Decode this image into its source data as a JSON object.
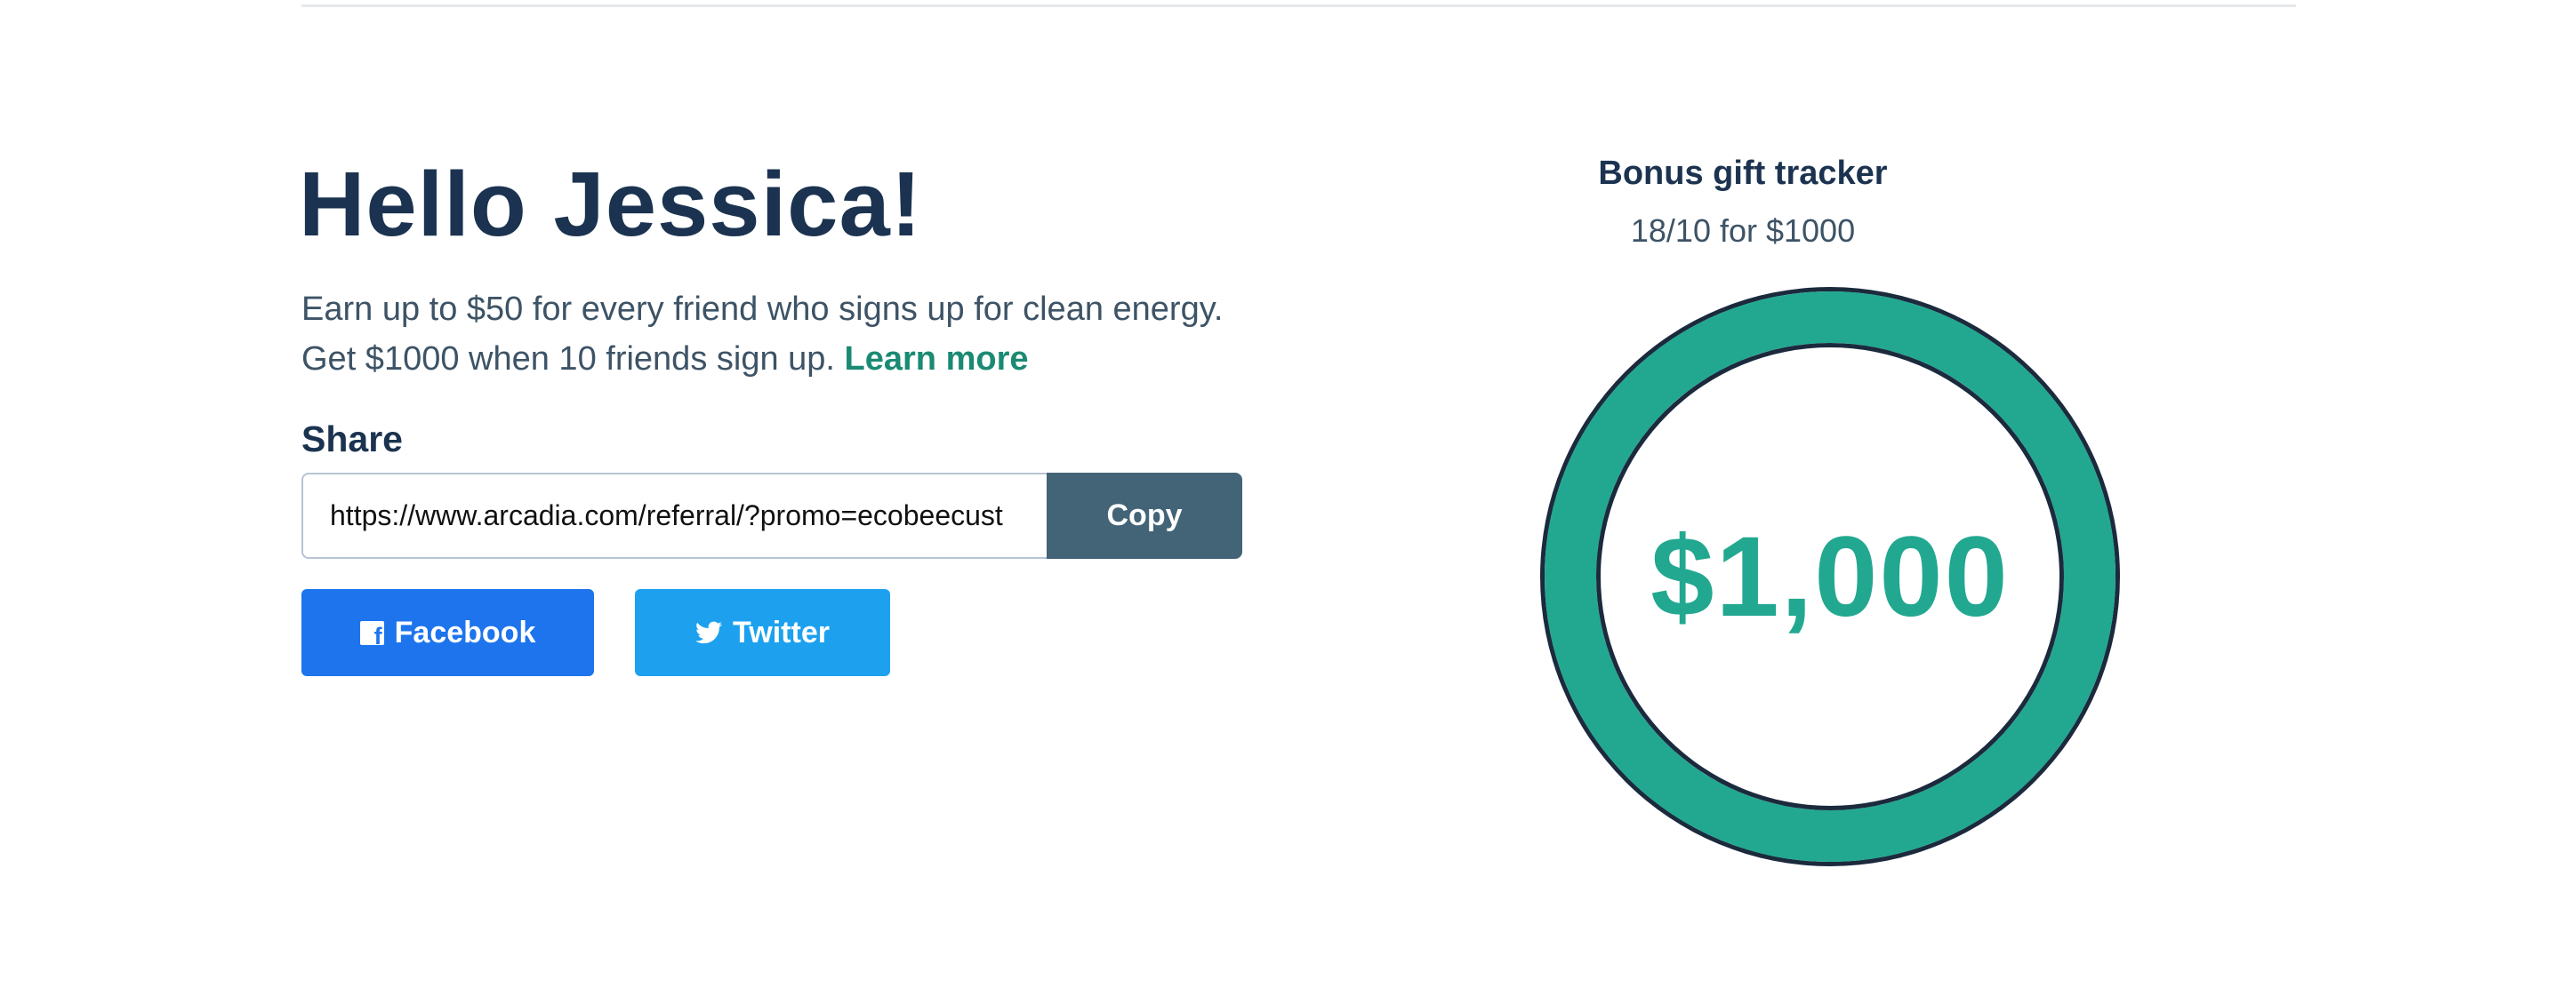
{
  "greeting": "Hello Jessica!",
  "intro": {
    "text": "Earn up to $50 for every friend who signs up for clean energy. Get $1000 when 10 friends sign up.",
    "learn_more": "Learn more"
  },
  "share": {
    "label": "Share",
    "referral_url": "https://www.arcadia.com/referral/?promo=ecobeecust",
    "copy_label": "Copy",
    "facebook_label": "Facebook",
    "twitter_label": "Twitter"
  },
  "tracker": {
    "title": "Bonus gift tracker",
    "progress_text": "18/10 for $1000",
    "amount": "$1,000",
    "progress_fraction": 1.0
  },
  "colors": {
    "brand_teal": "#22a891",
    "navy": "#1b3350",
    "copy_button": "#436377",
    "facebook": "#1d74ed",
    "twitter": "#1da1ef"
  },
  "icons": {
    "facebook": "facebook-icon",
    "twitter": "twitter-bird-icon"
  }
}
